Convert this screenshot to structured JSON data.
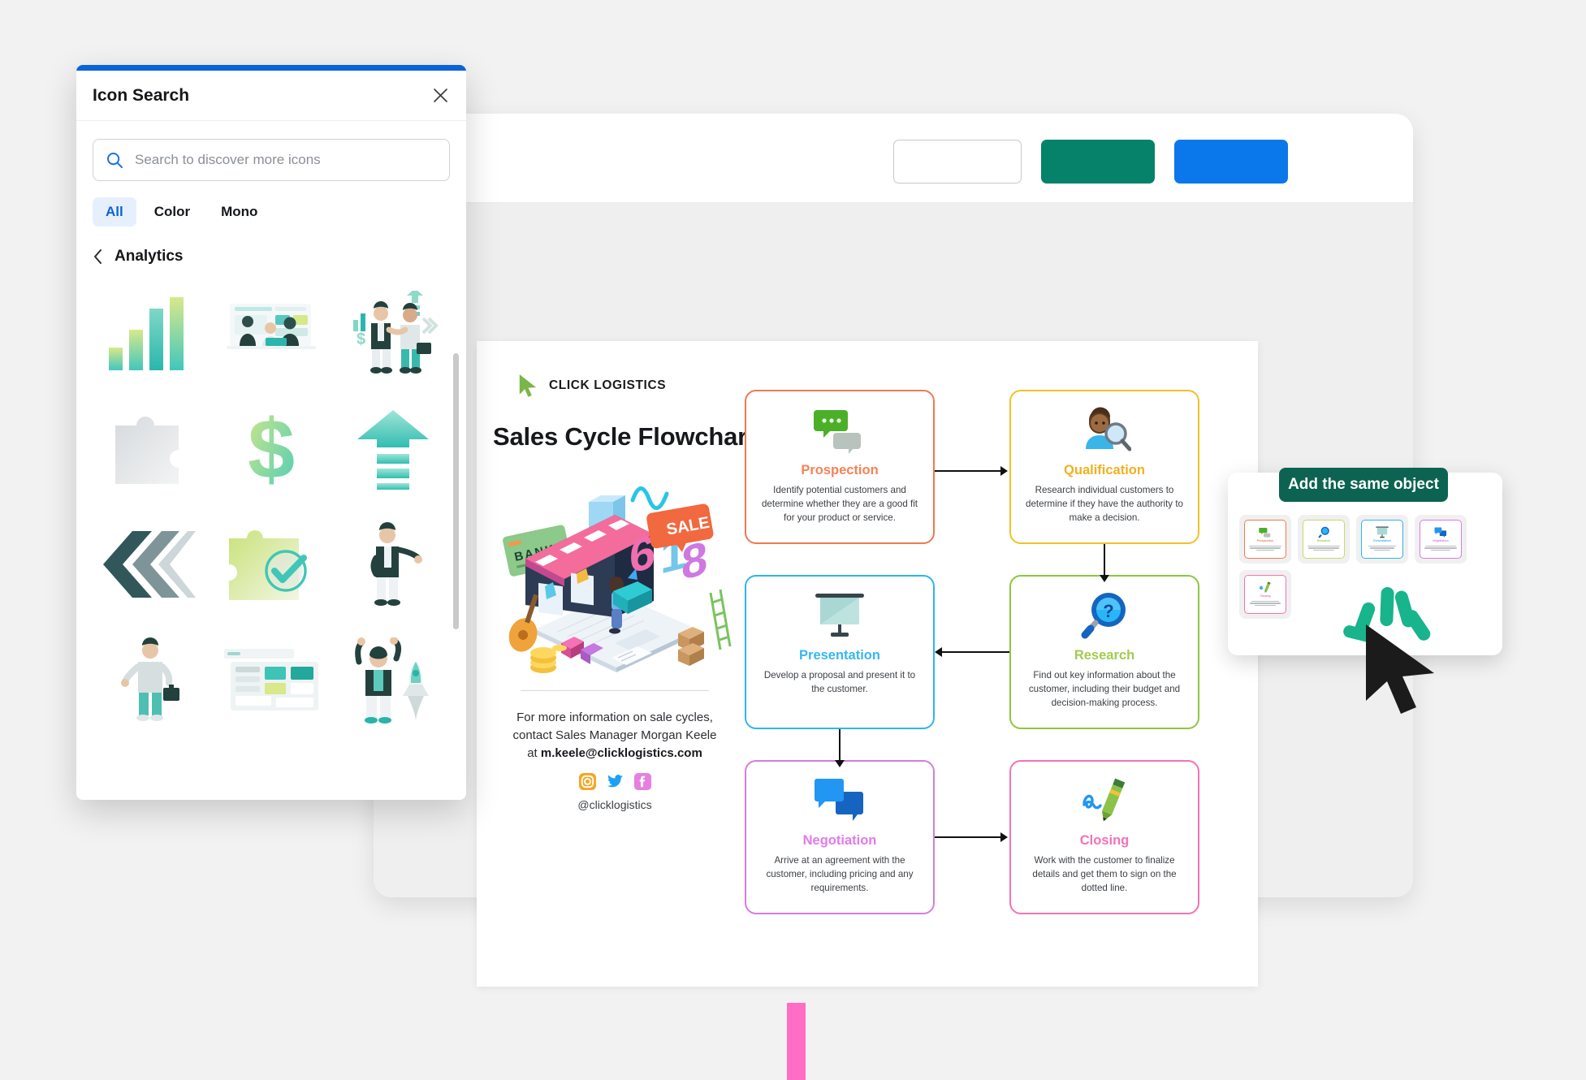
{
  "icon_search_panel": {
    "title": "Icon Search",
    "close_label": "×",
    "search": {
      "placeholder": "Search to discover more icons",
      "value": ""
    },
    "filters": [
      {
        "label": "All",
        "active": true
      },
      {
        "label": "Color",
        "active": false
      },
      {
        "label": "Mono",
        "active": false
      }
    ],
    "category": {
      "back_label": "‹",
      "name": "Analytics"
    },
    "icons": [
      {
        "name": "bar-chart-icon"
      },
      {
        "name": "team-meeting-illustration-icon"
      },
      {
        "name": "business-handshake-illustration-icon"
      },
      {
        "name": "puzzle-piece-icon"
      },
      {
        "name": "dollar-sign-icon"
      },
      {
        "name": "upward-arrow-icon"
      },
      {
        "name": "double-chevron-left-icon"
      },
      {
        "name": "puzzle-check-icon"
      },
      {
        "name": "presenting-person-illustration-icon"
      },
      {
        "name": "businessman-briefcase-illustration-icon"
      },
      {
        "name": "dashboard-window-icon"
      },
      {
        "name": "celebrating-person-rocket-illustration-icon"
      }
    ]
  },
  "toolbar": {
    "buttons": [
      {
        "name": "outline-button",
        "label": ""
      },
      {
        "name": "green-button",
        "label": ""
      },
      {
        "name": "blue-button",
        "label": ""
      }
    ]
  },
  "document": {
    "brand": {
      "name": "CLICK LOGISTICS",
      "logo_icon": "green-cursor-arrow-icon"
    },
    "title": "Sales Cycle Flowchart",
    "hero_illustration": "ecommerce-618-sale-isometric-illustration",
    "contact": {
      "line1": "For more information on sale cycles,",
      "line2": "contact Sales Manager Morgan Keele",
      "line3_prefix": "at ",
      "email": "m.keele@clicklogistics.com",
      "handle": "@clicklogistics",
      "socials": [
        {
          "name": "instagram-icon",
          "color": "#f5a623"
        },
        {
          "name": "twitter-icon",
          "color": "#1da1f2"
        },
        {
          "name": "facebook-icon",
          "color": "#e77fe0"
        }
      ]
    },
    "flowchart": {
      "steps": [
        {
          "key": "prospection",
          "name": "Prospection",
          "description": "Identify potential customers and determine whether they are a good fit for your product or service.",
          "border_color": "#ef7a52",
          "title_color": "#f58357",
          "icon": "green-speech-bubbles-icon"
        },
        {
          "key": "qualification",
          "name": "Qualification",
          "description": "Research individual customers to determine if they have the authority to make a decision.",
          "border_color": "#f2c02a",
          "title_color": "#f2b01f",
          "icon": "person-magnifier-icon"
        },
        {
          "key": "presentation",
          "name": "Presentation",
          "description": "Develop a proposal and present it to the customer.",
          "border_color": "#2fb4ef",
          "title_color": "#37b7f0",
          "icon": "projector-screen-icon"
        },
        {
          "key": "research",
          "name": "Research",
          "description": "Find out key information about the customer, including their budget and decision-making process.",
          "border_color": "#8dc63f",
          "title_color": "#a3cb4d",
          "icon": "magnifier-question-icon"
        },
        {
          "key": "negotiation",
          "name": "Negotiation",
          "description": "Arrive at an agreement with the customer, including pricing and any requirements.",
          "border_color": "#d77be0",
          "title_color": "#e27ae8",
          "icon": "blue-speech-bubbles-icon"
        },
        {
          "key": "closing",
          "name": "Closing",
          "description": "Work with the customer to finalize details and get them to sign on the dotted line.",
          "border_color": "#f472b6",
          "title_color": "#f472b6",
          "icon": "pen-signature-icon"
        }
      ]
    }
  },
  "same_object_popup": {
    "button_label": "Add the same object",
    "thumbnails": [
      {
        "name": "Prospection",
        "color": "#f58357",
        "border": "#ef7a52",
        "icon": "green-speech-bubbles-icon"
      },
      {
        "name": "Research",
        "color": "#a3cb4d",
        "border": "#c9d96a",
        "icon": "magnifier-question-icon"
      },
      {
        "name": "Presentation",
        "color": "#37b7f0",
        "border": "#2fb4ef",
        "icon": "projector-screen-icon"
      },
      {
        "name": "Negotiation",
        "color": "#e27ae8",
        "border": "#d77be0",
        "icon": "blue-speech-bubbles-icon"
      },
      {
        "name": "Closing",
        "color": "#f472b6",
        "border": "#f472b6",
        "icon": "pen-signature-icon"
      }
    ]
  },
  "cursor": {
    "name": "mouse-pointer-cursor",
    "click_burst": "click-burst-indicator",
    "color": "#14b286"
  }
}
